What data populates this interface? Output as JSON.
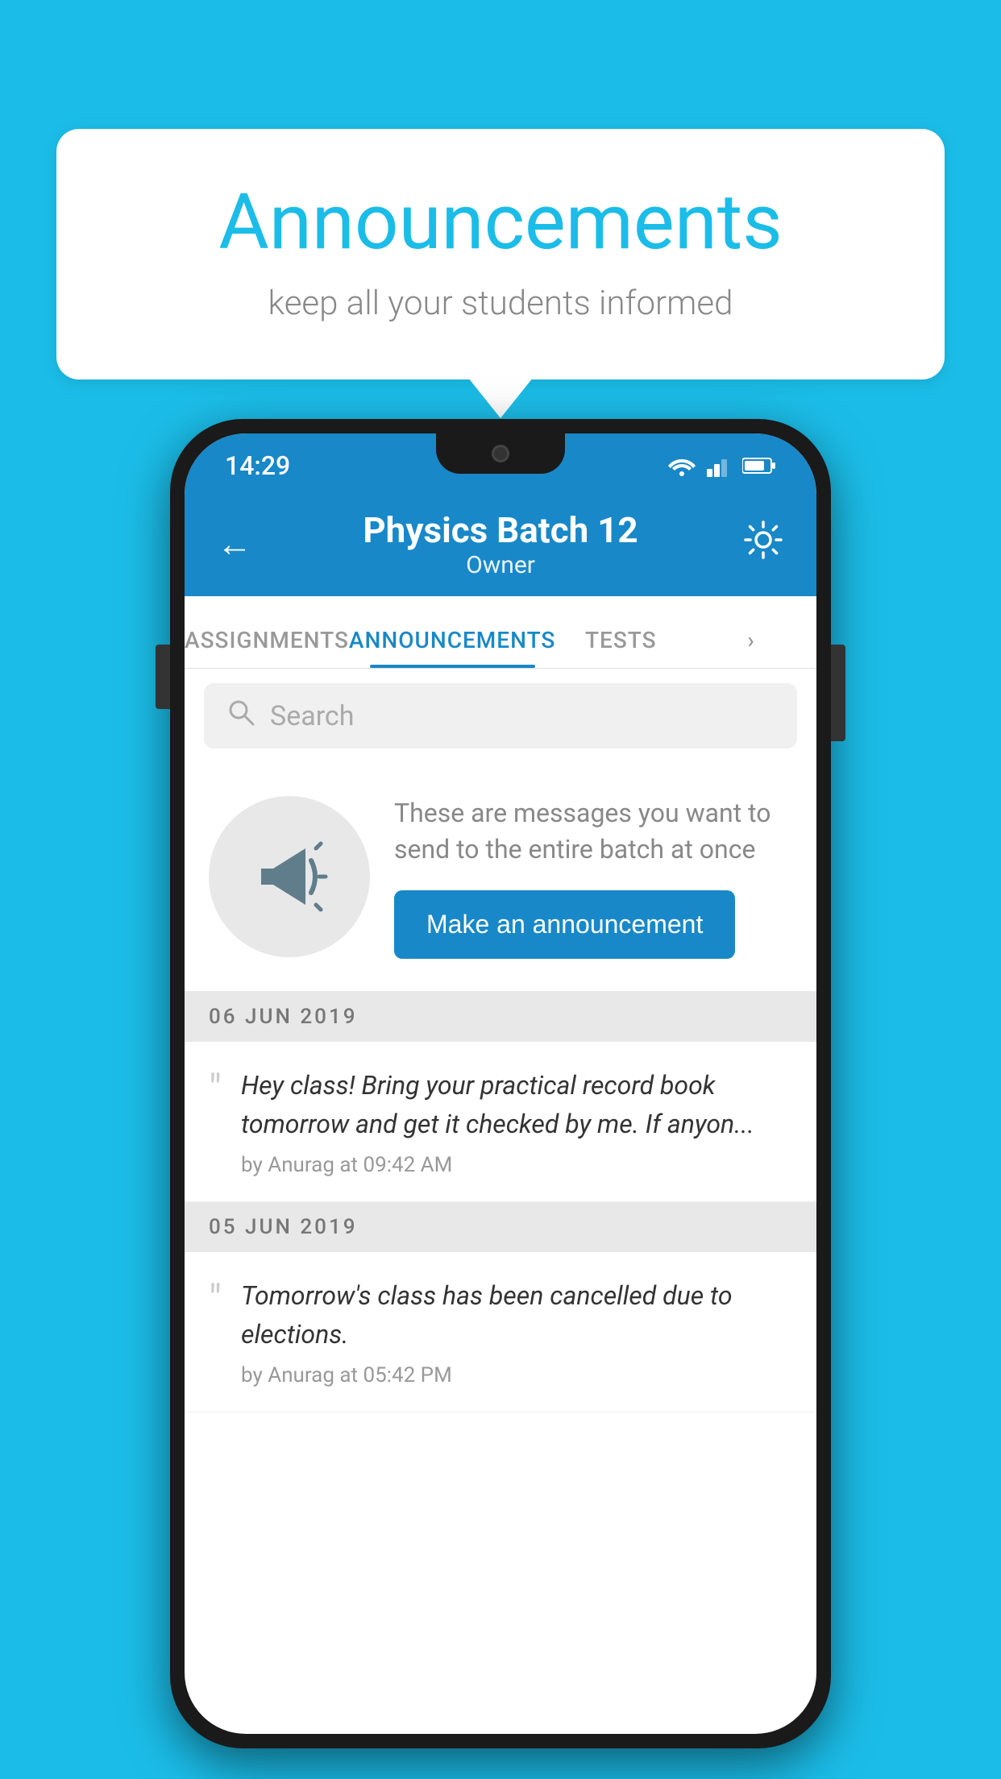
{
  "background_color": "#1bbde8",
  "speech_bubble": {
    "title": "Announcements",
    "subtitle": "keep all your students informed"
  },
  "phone": {
    "status_bar": {
      "time": "14:29"
    },
    "app_bar": {
      "title": "Physics Batch 12",
      "subtitle": "Owner",
      "back_label": "←",
      "gear_label": "⚙"
    },
    "tabs": [
      {
        "label": "ASSIGNMENTS",
        "active": false
      },
      {
        "label": "ANNOUNCEMENTS",
        "active": true
      },
      {
        "label": "TESTS",
        "active": false
      },
      {
        "label": "...",
        "active": false
      }
    ],
    "search": {
      "placeholder": "Search"
    },
    "promo": {
      "description_text": "These are messages you want to send to the entire batch at once",
      "button_label": "Make an announcement"
    },
    "announcements": [
      {
        "date": "06  JUN  2019",
        "text": "Hey class! Bring your practical record book tomorrow and get it checked by me. If anyon...",
        "meta": "by Anurag at 09:42 AM"
      },
      {
        "date": "05  JUN  2019",
        "text": "Tomorrow's class has been cancelled due to elections.",
        "meta": "by Anurag at 05:42 PM"
      }
    ]
  }
}
